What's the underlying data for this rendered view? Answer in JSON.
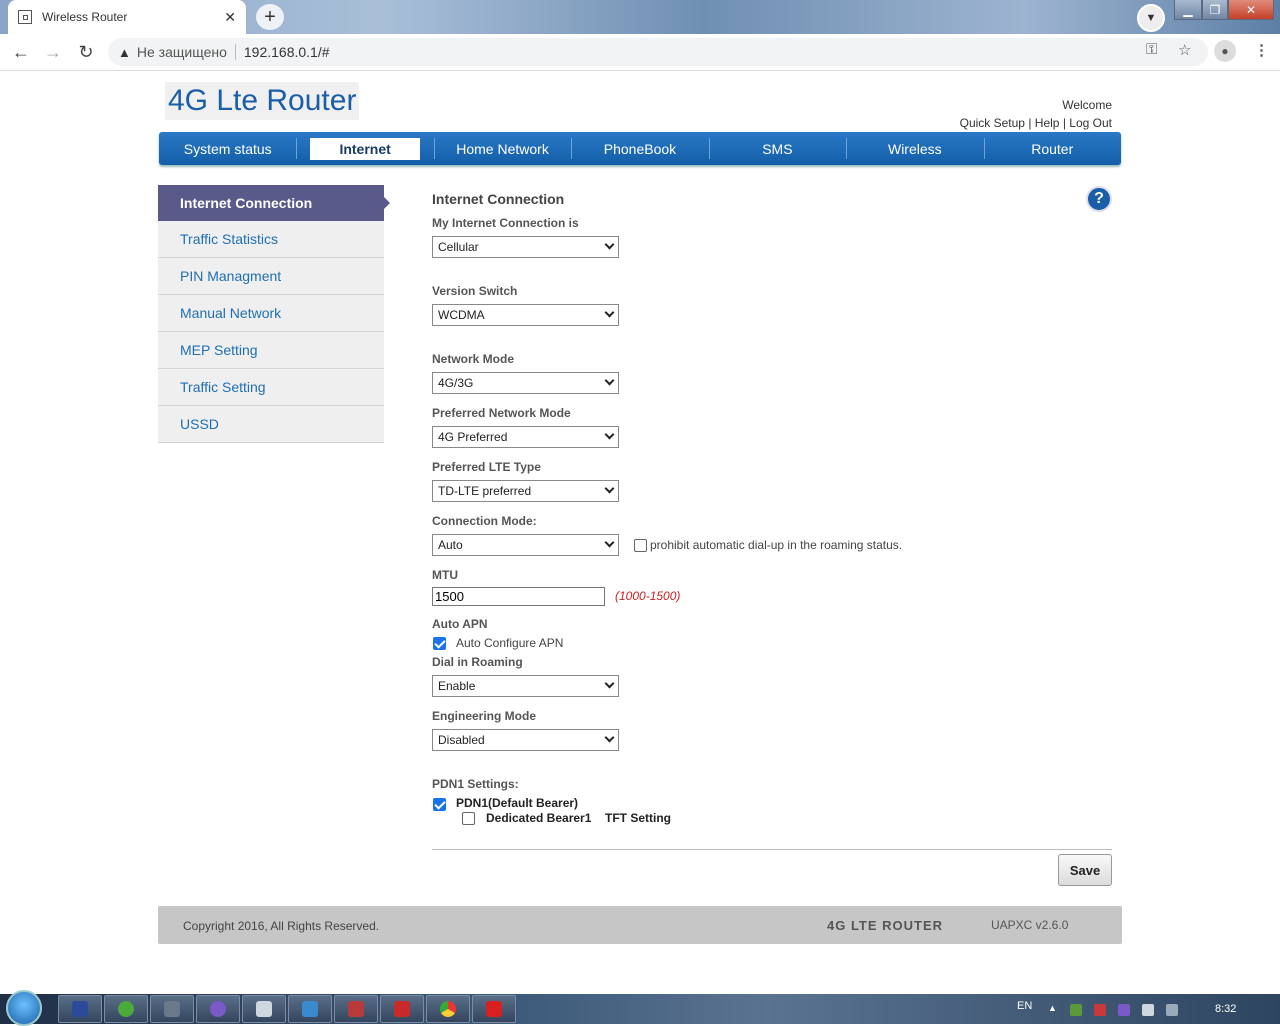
{
  "browser": {
    "tab_title": "Wireless Router",
    "security_label": "Не защищено",
    "url": "192.168.0.1/#"
  },
  "header": {
    "logo": "4G Lte Router",
    "welcome": "Welcome",
    "quick_setup": "Quick Setup",
    "help": "Help",
    "log_out": "Log Out",
    "sep": "|"
  },
  "nav": {
    "items": [
      "System status",
      "Internet",
      "Home Network",
      "PhoneBook",
      "SMS",
      "Wireless",
      "Router"
    ],
    "active": "Internet"
  },
  "sidebar": {
    "items": [
      "Internet Connection",
      "Traffic Statistics",
      "PIN Managment",
      "Manual Network",
      "MEP Setting",
      "Traffic Setting",
      "USSD"
    ],
    "active": "Internet Connection"
  },
  "form": {
    "title": "Internet Connection",
    "help_glyph": "?",
    "connection_label": "My Internet Connection is",
    "connection_value": "Cellular",
    "version_label": "Version Switch",
    "version_value": "WCDMA",
    "network_mode_label": "Network Mode",
    "network_mode_value": "4G/3G",
    "pref_mode_label": "Preferred Network Mode",
    "pref_mode_value": "4G Preferred",
    "pref_lte_label": "Preferred LTE Type",
    "pref_lte_value": "TD-LTE preferred",
    "conn_mode_label": "Connection Mode:",
    "conn_mode_value": "Auto",
    "roaming_prohibit_label": "prohibit automatic dial-up in the roaming status.",
    "roaming_prohibit_checked": false,
    "mtu_label": "MTU",
    "mtu_value": "1500",
    "mtu_hint": "(1000-1500)",
    "auto_apn_label": "Auto APN",
    "auto_apn_cb_label": "Auto Configure APN",
    "auto_apn_checked": true,
    "dial_roaming_label": "Dial in Roaming",
    "dial_roaming_value": "Enable",
    "eng_mode_label": "Engineering Mode",
    "eng_mode_value": "Disabled",
    "pdn_label": "PDN1 Settings:",
    "pdn_default_label": "PDN1(Default Bearer)",
    "pdn_default_checked": true,
    "dedicated_label": "Dedicated Bearer1",
    "dedicated_checked": false,
    "tft_label": "TFT Setting",
    "save_label": "Save"
  },
  "footer": {
    "copyright": "Copyright 2016, All Rights Reserved.",
    "brand": "4G LTE ROUTER",
    "version": "UAPXC v2.6.0"
  },
  "taskbar": {
    "lang": "EN",
    "time": "8:32",
    "apps": [
      "save-app-icon",
      "utorrent-icon",
      "monitor-app-icon",
      "viber-icon",
      "notepad-icon",
      "remote-desktop-icon",
      "archive-icon",
      "toolbox-icon",
      "chrome-icon",
      "maple-app-icon"
    ]
  },
  "colors": {
    "nav_blue": "#1a66b4",
    "sidebar_active": "#5a5a8a",
    "link_blue": "#1f6fb0",
    "hint_red": "#cc2222"
  }
}
